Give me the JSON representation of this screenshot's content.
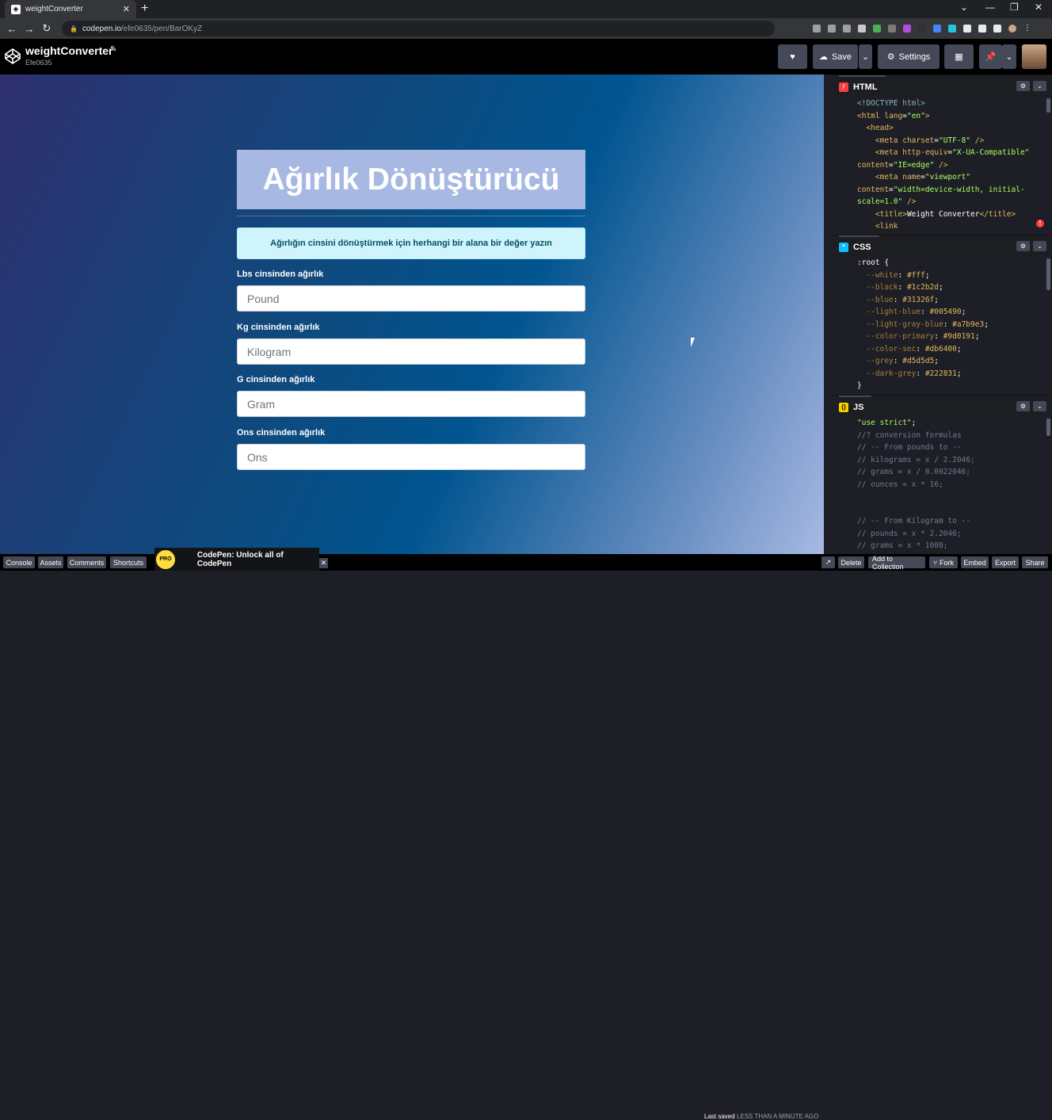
{
  "browser": {
    "tab_title": "weightConverter",
    "url_host": "codepen.io",
    "url_path": "/efe0635/pen/BarOKyZ"
  },
  "header": {
    "pen_title": "weightConverter",
    "author": "Efe0635",
    "save_label": "Save",
    "settings_label": "Settings"
  },
  "preview": {
    "heading": "Ağırlık Dönüştürücü",
    "info": "Ağırlığın cinsini dönüştürmek için herhangi bir alana bir değer yazın",
    "fields": [
      {
        "label": "Lbs cinsinden ağırlık",
        "placeholder": "Pound"
      },
      {
        "label": "Kg cinsinden ağırlık",
        "placeholder": "Kilogram"
      },
      {
        "label": "G cinsinden ağırlık",
        "placeholder": "Gram"
      },
      {
        "label": "Ons cinsinden ağırlık",
        "placeholder": "Ons"
      }
    ]
  },
  "editors": {
    "html": {
      "title": "HTML"
    },
    "css": {
      "title": "CSS"
    },
    "js": {
      "title": "JS"
    }
  },
  "footer": {
    "console": "Console",
    "assets": "Assets",
    "comments": "Comments",
    "shortcuts": "Shortcuts",
    "promo": "CodePen: Unlock all of CodePen",
    "pro_badge": "PRO",
    "last_saved_prefix": "Last saved",
    "last_saved_value": "LESS THAN A MINUTE AGO",
    "delete": "Delete",
    "add_to_collection": "Add to Collection",
    "fork": "Fork",
    "embed": "Embed",
    "export": "Export",
    "share": "Share"
  }
}
